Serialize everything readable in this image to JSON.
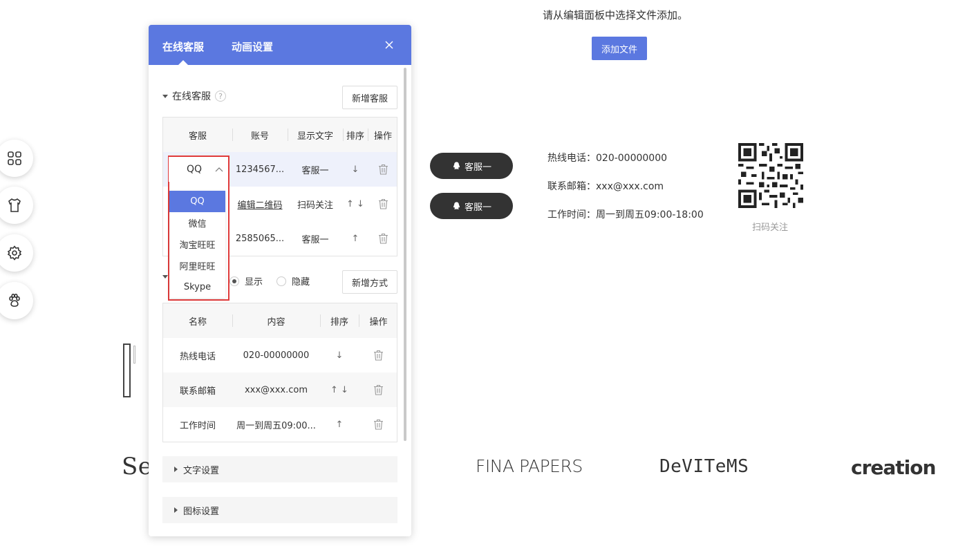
{
  "top": {
    "hint": "请从编辑面板中选择文件添加。",
    "add_file": "添加文件"
  },
  "preview": {
    "pills": [
      "客服一",
      "客服一"
    ],
    "phone": "热线电话：020-00000000",
    "email": "联系邮箱：xxx@xxx.com",
    "hours": "工作时间：周一到周五09:00-18:00",
    "qr_caption": "扫码关注"
  },
  "brands": [
    "FINA PAPERS",
    "DeVITeMS",
    "creation"
  ],
  "brand_left": "Se",
  "sidebar": {
    "icons": [
      "grid-icon",
      "shirt-icon",
      "gear-icon",
      "paw-icon"
    ]
  },
  "panel": {
    "tabs": [
      "在线客服",
      "动画设置"
    ],
    "online_section": {
      "title": "在线客服",
      "help": "?",
      "add_button": "新增客服"
    },
    "service_table": {
      "headers": [
        "客服",
        "账号",
        "显示文字",
        "排序",
        "操作"
      ],
      "rows": [
        {
          "type": "QQ",
          "account": "1234567...",
          "text": "客服一",
          "sort": "↓"
        },
        {
          "type": "",
          "account": "编辑二维码",
          "text": "扫码关注",
          "sort": "↑ ↓"
        },
        {
          "type": "",
          "account": "2585065...",
          "text": "客服一",
          "sort": "↑"
        }
      ]
    },
    "dropdown": {
      "options": [
        "QQ",
        "微信",
        "淘宝旺旺",
        "阿里旺旺",
        "Skype"
      ],
      "selected": "QQ"
    },
    "contact_section": {
      "show": "显示",
      "hide": "隐藏",
      "add_button": "新增方式"
    },
    "contact_table": {
      "headers": [
        "名称",
        "内容",
        "排序",
        "操作"
      ],
      "rows": [
        {
          "name": "热线电话",
          "content": "020-00000000",
          "sort": "↓"
        },
        {
          "name": "联系邮箱",
          "content": "xxx@xxx.com",
          "sort": "↑ ↓"
        },
        {
          "name": "工作时间",
          "content": "周一到周五09:00...",
          "sort": "↑"
        }
      ]
    },
    "collapsed": [
      "文字设置",
      "图标设置"
    ]
  },
  "colors": {
    "accent": "#5b78e0",
    "highlight_border": "#e03a3a",
    "pill": "#333333"
  }
}
